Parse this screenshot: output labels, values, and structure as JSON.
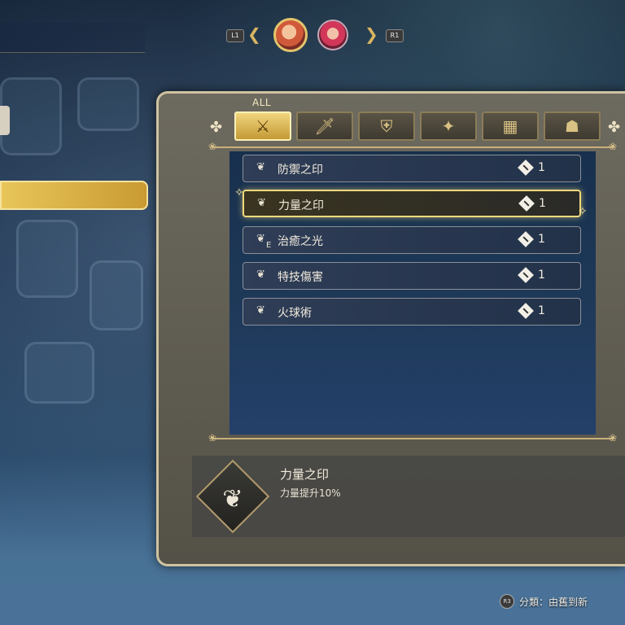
{
  "character_switch": {
    "left_button": "L1",
    "right_button": "R1",
    "characters": [
      {
        "name_icon": "character-portrait-active"
      },
      {
        "name_icon": "character-portrait-second"
      }
    ]
  },
  "category_tabs": {
    "all_label": "ALL",
    "tabs": [
      {
        "icon": "all-items-icon",
        "glyph": "⚔"
      },
      {
        "icon": "sword-icon",
        "glyph": "🗡"
      },
      {
        "icon": "shield-icon",
        "glyph": "⛨"
      },
      {
        "icon": "accessory-icon",
        "glyph": "✦"
      },
      {
        "icon": "grid-icon",
        "glyph": "▦"
      },
      {
        "icon": "figure-icon",
        "glyph": "☗"
      }
    ],
    "active_index": 0
  },
  "items": [
    {
      "name": "防禦之印",
      "quantity": "1",
      "equipped": false,
      "selected": false
    },
    {
      "name": "力量之印",
      "quantity": "1",
      "equipped": false,
      "selected": true
    },
    {
      "name": "治癒之光",
      "quantity": "1",
      "equipped": true,
      "equip_mark": "E",
      "selected": false
    },
    {
      "name": "特技傷害",
      "quantity": "1",
      "equipped": false,
      "selected": false
    },
    {
      "name": "火球術",
      "quantity": "1",
      "equipped": false,
      "selected": false
    }
  ],
  "detail": {
    "title": "力量之印",
    "description": "力量提升10%",
    "icon": "seed-icon"
  },
  "footer_hint": {
    "button": "R3",
    "text": "分類：由舊到新"
  },
  "colors": {
    "accent_gold": "#e8c65a",
    "panel": "#5e5b51",
    "list_bg": "#1f3a5a"
  }
}
